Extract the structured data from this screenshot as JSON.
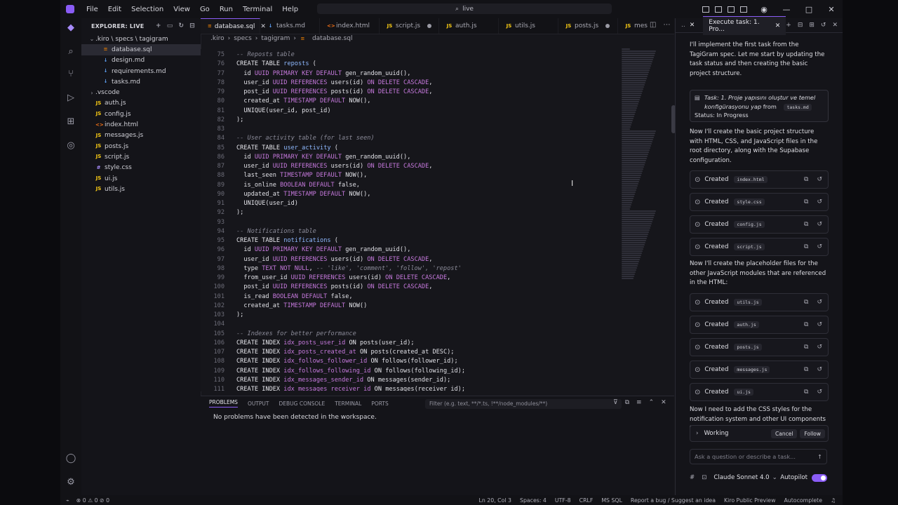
{
  "titlebar": {
    "menus": [
      "File",
      "Edit",
      "Selection",
      "View",
      "Go",
      "Run",
      "Terminal",
      "Help"
    ],
    "search": "live"
  },
  "explorer": {
    "header": "EXPLORER: LIVE",
    "items": [
      {
        "label": ".kiro \\ specs \\ tagigram",
        "indent": 0,
        "chev": "⌄",
        "icon": "",
        "color": ""
      },
      {
        "label": "database.sql",
        "indent": 1,
        "chev": "",
        "icon": "≡",
        "color": "#d97706",
        "selected": true
      },
      {
        "label": "design.md",
        "indent": 1,
        "chev": "",
        "icon": "↓",
        "color": "#60a5fa"
      },
      {
        "label": "requirements.md",
        "indent": 1,
        "chev": "",
        "icon": "↓",
        "color": "#60a5fa"
      },
      {
        "label": "tasks.md",
        "indent": 1,
        "chev": "",
        "icon": "↓",
        "color": "#60a5fa"
      },
      {
        "label": ".vscode",
        "indent": 0,
        "chev": "›",
        "icon": "",
        "color": ""
      },
      {
        "label": "auth.js",
        "indent": 0,
        "chev": "",
        "icon": "JS",
        "color": "#facc15"
      },
      {
        "label": "config.js",
        "indent": 0,
        "chev": "",
        "icon": "JS",
        "color": "#facc15"
      },
      {
        "label": "index.html",
        "indent": 0,
        "chev": "",
        "icon": "<>",
        "color": "#f97316"
      },
      {
        "label": "messages.js",
        "indent": 0,
        "chev": "",
        "icon": "JS",
        "color": "#facc15"
      },
      {
        "label": "posts.js",
        "indent": 0,
        "chev": "",
        "icon": "JS",
        "color": "#facc15"
      },
      {
        "label": "script.js",
        "indent": 0,
        "chev": "",
        "icon": "JS",
        "color": "#facc15"
      },
      {
        "label": "style.css",
        "indent": 0,
        "chev": "",
        "icon": "#",
        "color": "#a78bfa"
      },
      {
        "label": "ui.js",
        "indent": 0,
        "chev": "",
        "icon": "JS",
        "color": "#facc15"
      },
      {
        "label": "utils.js",
        "indent": 0,
        "chev": "",
        "icon": "JS",
        "color": "#facc15"
      }
    ]
  },
  "tabs": [
    {
      "label": "database.sql",
      "active": true,
      "icon": "≡",
      "color": "#d97706",
      "end": "x"
    },
    {
      "label": "tasks.md",
      "icon": "↓",
      "color": "#60a5fa",
      "end": ""
    },
    {
      "label": "index.html",
      "icon": "<>",
      "color": "#f97316",
      "end": ""
    },
    {
      "label": "script.js",
      "icon": "JS",
      "color": "#facc15",
      "end": "dot"
    },
    {
      "label": "auth.js",
      "icon": "JS",
      "color": "#facc15",
      "end": ""
    },
    {
      "label": "utils.js",
      "icon": "JS",
      "color": "#facc15",
      "end": ""
    },
    {
      "label": "posts.js",
      "icon": "JS",
      "color": "#facc15",
      "end": "dot"
    },
    {
      "label": "mes",
      "icon": "JS",
      "color": "#facc15",
      "end": ""
    }
  ],
  "breadcrumb": [
    ".kiro",
    "specs",
    "tagigram",
    "database.sql"
  ],
  "code_lines": [
    {
      "n": "75",
      "h": "<span class='c'>-- Reposts table</span>"
    },
    {
      "n": "76",
      "h": "<span class='k'>CREATE TABLE</span> <span class='f'>reposts</span> ("
    },
    {
      "n": "77",
      "h": "  id <span class='t'>UUID</span> <span class='t'>PRIMARY KEY DEFAULT</span> gen_random_uuid(),"
    },
    {
      "n": "78",
      "h": "  user_id <span class='t'>UUID</span> <span class='t'>REFERENCES</span> users(id) <span class='t'>ON DELETE CASCADE</span>,"
    },
    {
      "n": "79",
      "h": "  post_id <span class='t'>UUID</span> <span class='t'>REFERENCES</span> posts(id) <span class='t'>ON DELETE CASCADE</span>,"
    },
    {
      "n": "80",
      "h": "  created_at <span class='t'>TIMESTAMP DEFAULT</span> NOW(),"
    },
    {
      "n": "81",
      "h": "  UNIQUE(user_id, post_id)"
    },
    {
      "n": "82",
      "h": ");"
    },
    {
      "n": "83",
      "h": ""
    },
    {
      "n": "84",
      "h": "<span class='c'>-- User activity table (for last seen)</span>"
    },
    {
      "n": "85",
      "h": "<span class='k'>CREATE TABLE</span> <span class='f'>user_activity</span> ("
    },
    {
      "n": "86",
      "h": "  id <span class='t'>UUID</span> <span class='t'>PRIMARY KEY DEFAULT</span> gen_random_uuid(),"
    },
    {
      "n": "87",
      "h": "  user_id <span class='t'>UUID</span> <span class='t'>REFERENCES</span> users(id) <span class='t'>ON DELETE CASCADE</span>,"
    },
    {
      "n": "88",
      "h": "  last_seen <span class='t'>TIMESTAMP DEFAULT</span> NOW(),"
    },
    {
      "n": "89",
      "h": "  is_online <span class='t'>BOOLEAN DEFAULT</span> false,"
    },
    {
      "n": "90",
      "h": "  updated_at <span class='t'>TIMESTAMP DEFAULT</span> NOW(),"
    },
    {
      "n": "91",
      "h": "  UNIQUE(user_id)"
    },
    {
      "n": "92",
      "h": ");"
    },
    {
      "n": "93",
      "h": ""
    },
    {
      "n": "94",
      "h": "<span class='c'>-- Notifications table</span>"
    },
    {
      "n": "95",
      "h": "<span class='k'>CREATE TABLE</span> <span class='f'>notifications</span> ("
    },
    {
      "n": "96",
      "h": "  id <span class='t'>UUID</span> <span class='t'>PRIMARY KEY DEFAULT</span> gen_random_uuid(),"
    },
    {
      "n": "97",
      "h": "  user_id <span class='t'>UUID</span> <span class='t'>REFERENCES</span> users(id) <span class='t'>ON DELETE CASCADE</span>,"
    },
    {
      "n": "98",
      "h": "  type <span class='t'>TEXT NOT NULL</span>, <span class='c'>-- 'like', 'comment', 'follow', 'repost'</span>"
    },
    {
      "n": "99",
      "h": "  from_user_id <span class='t'>UUID</span> <span class='t'>REFERENCES</span> users(id) <span class='t'>ON DELETE CASCADE</span>,"
    },
    {
      "n": "100",
      "h": "  post_id <span class='t'>UUID</span> <span class='t'>REFERENCES</span> posts(id) <span class='t'>ON DELETE CASCADE</span>,"
    },
    {
      "n": "101",
      "h": "  is_read <span class='t'>BOOLEAN DEFAULT</span> false,"
    },
    {
      "n": "102",
      "h": "  created_at <span class='t'>TIMESTAMP DEFAULT</span> NOW()"
    },
    {
      "n": "103",
      "h": ");"
    },
    {
      "n": "104",
      "h": ""
    },
    {
      "n": "105",
      "h": "<span class='c'>-- Indexes for better performance</span>"
    },
    {
      "n": "106",
      "h": "<span class='k'>CREATE INDEX</span> <span class='t'>idx_posts_user_id</span> <span class='k'>ON</span> posts(user_id);"
    },
    {
      "n": "107",
      "h": "<span class='k'>CREATE INDEX</span> <span class='t'>idx_posts_created_at</span> <span class='k'>ON</span> posts(created_at DESC);"
    },
    {
      "n": "108",
      "h": "<span class='k'>CREATE INDEX</span> <span class='t'>idx_follows_follower_id</span> <span class='k'>ON</span> follows(follower_id);"
    },
    {
      "n": "109",
      "h": "<span class='k'>CREATE INDEX</span> <span class='t'>idx_follows_following_id</span> <span class='k'>ON</span> follows(following_id);"
    },
    {
      "n": "110",
      "h": "<span class='k'>CREATE INDEX</span> <span class='t'>idx_messages_sender_id</span> <span class='k'>ON</span> messages(sender_id);"
    },
    {
      "n": "111",
      "h": "<span class='k'>CREATE INDEX</span> <span class='t'>idx_messages_receiver_id</span> <span class='k'>ON</span> messages(receiver_id);"
    }
  ],
  "panel": {
    "tabs": [
      "PROBLEMS",
      "OUTPUT",
      "DEBUG CONSOLE",
      "TERMINAL",
      "PORTS"
    ],
    "filter_placeholder": "Filter (e.g. text, **/*.ts, !**/node_modules/**)",
    "message": "No problems have been detected in the workspace."
  },
  "chat": {
    "tab_title": "Execute task: 1. Pro...",
    "intro": "I'll implement the first task from the TagiGram spec. Let me start by updating the task status and then creating the basic project structure.",
    "task_card": {
      "title": "Task: 1. Proje yapısını oluştur ve temel konfigürasyonu yap",
      "from": "from",
      "file": "tasks.md",
      "status": "Status: In Progress"
    },
    "msg2": "Now I'll create the basic project structure with HTML, CSS, and JavaScript files in the root directory, along with the Supabase configuration.",
    "created_label": "Created",
    "group1": [
      "index.html",
      "style.css",
      "config.js",
      "script.js"
    ],
    "msg3": "Now I'll create the placeholder files for the other JavaScript modules that are referenced in the HTML:",
    "group2": [
      "utils.js",
      "auth.js",
      "posts.js",
      "messages.js",
      "ui.js"
    ],
    "msg4": "Now I need to add the CSS styles for the notification system and other UI components that were referenced in the UI manager:",
    "working": "Working",
    "cancel": "Cancel",
    "follow": "Follow",
    "ask_placeholder": "Ask a question or describe a task...",
    "model": "Claude Sonnet 4.0",
    "autopilot": "Autopilot"
  },
  "status": {
    "left": "⊗ 0 ⚠ 0   ⊘ 0",
    "position": "Ln 20, Col 3",
    "spaces": "Spaces: 4",
    "encoding": "UTF-8",
    "eol": "CRLF",
    "lang": "MS SQL",
    "report": "Report a bug / Suggest an idea",
    "preview": "Kiro Public Preview",
    "autocomplete": "Autocomplete"
  }
}
